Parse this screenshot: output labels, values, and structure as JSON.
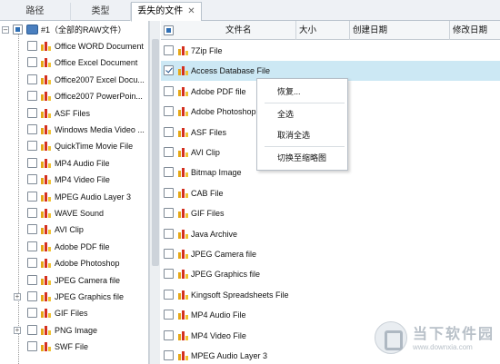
{
  "tabs": [
    {
      "label": "路径"
    },
    {
      "label": "类型"
    },
    {
      "label": "丢失的文件",
      "close": "✕"
    }
  ],
  "tree": {
    "root_label": "#1（全部的RAW文件）",
    "items": [
      {
        "label": "Office WORD Document"
      },
      {
        "label": "Office Excel Document"
      },
      {
        "label": "Office2007 Excel Docu..."
      },
      {
        "label": "Office2007 PowerPoin..."
      },
      {
        "label": "ASF Files"
      },
      {
        "label": "Windows Media Video ..."
      },
      {
        "label": "QuickTime Movie File"
      },
      {
        "label": "MP4 Audio File"
      },
      {
        "label": "MP4 Video File"
      },
      {
        "label": "MPEG Audio Layer 3"
      },
      {
        "label": "WAVE Sound"
      },
      {
        "label": "AVI Clip"
      },
      {
        "label": "Adobe PDF file"
      },
      {
        "label": "Adobe Photoshop"
      },
      {
        "label": "JPEG Camera file"
      },
      {
        "label": "JPEG Graphics file"
      },
      {
        "label": "GIF Files"
      },
      {
        "label": "PNG Image"
      },
      {
        "label": "SWF File"
      }
    ]
  },
  "list": {
    "columns": [
      "文件名",
      "大小",
      "创建日期",
      "修改日期"
    ],
    "rows": [
      {
        "label": "7Zip File",
        "checked": false
      },
      {
        "label": "Access Database File",
        "checked": true
      },
      {
        "label": "Adobe PDF file",
        "checked": false
      },
      {
        "label": "Adobe Photoshop",
        "checked": false
      },
      {
        "label": "ASF Files",
        "checked": false
      },
      {
        "label": "AVI Clip",
        "checked": false
      },
      {
        "label": "Bitmap Image",
        "checked": false
      },
      {
        "label": "CAB File",
        "checked": false
      },
      {
        "label": "GIF Files",
        "checked": false
      },
      {
        "label": "Java Archive",
        "checked": false
      },
      {
        "label": "JPEG Camera file",
        "checked": false
      },
      {
        "label": "JPEG Graphics file",
        "checked": false
      },
      {
        "label": "Kingsoft Spreadsheets File",
        "checked": false
      },
      {
        "label": "MP4 Audio File",
        "checked": false
      },
      {
        "label": "MP4 Video File",
        "checked": false
      },
      {
        "label": "MPEG Audio Layer 3",
        "checked": false
      }
    ]
  },
  "context_menu": {
    "items": [
      "恢复...",
      "全选",
      "取消全选",
      "切换至缩略图"
    ]
  },
  "watermark": {
    "name": "当下软件园",
    "url": "www.downxia.com"
  }
}
